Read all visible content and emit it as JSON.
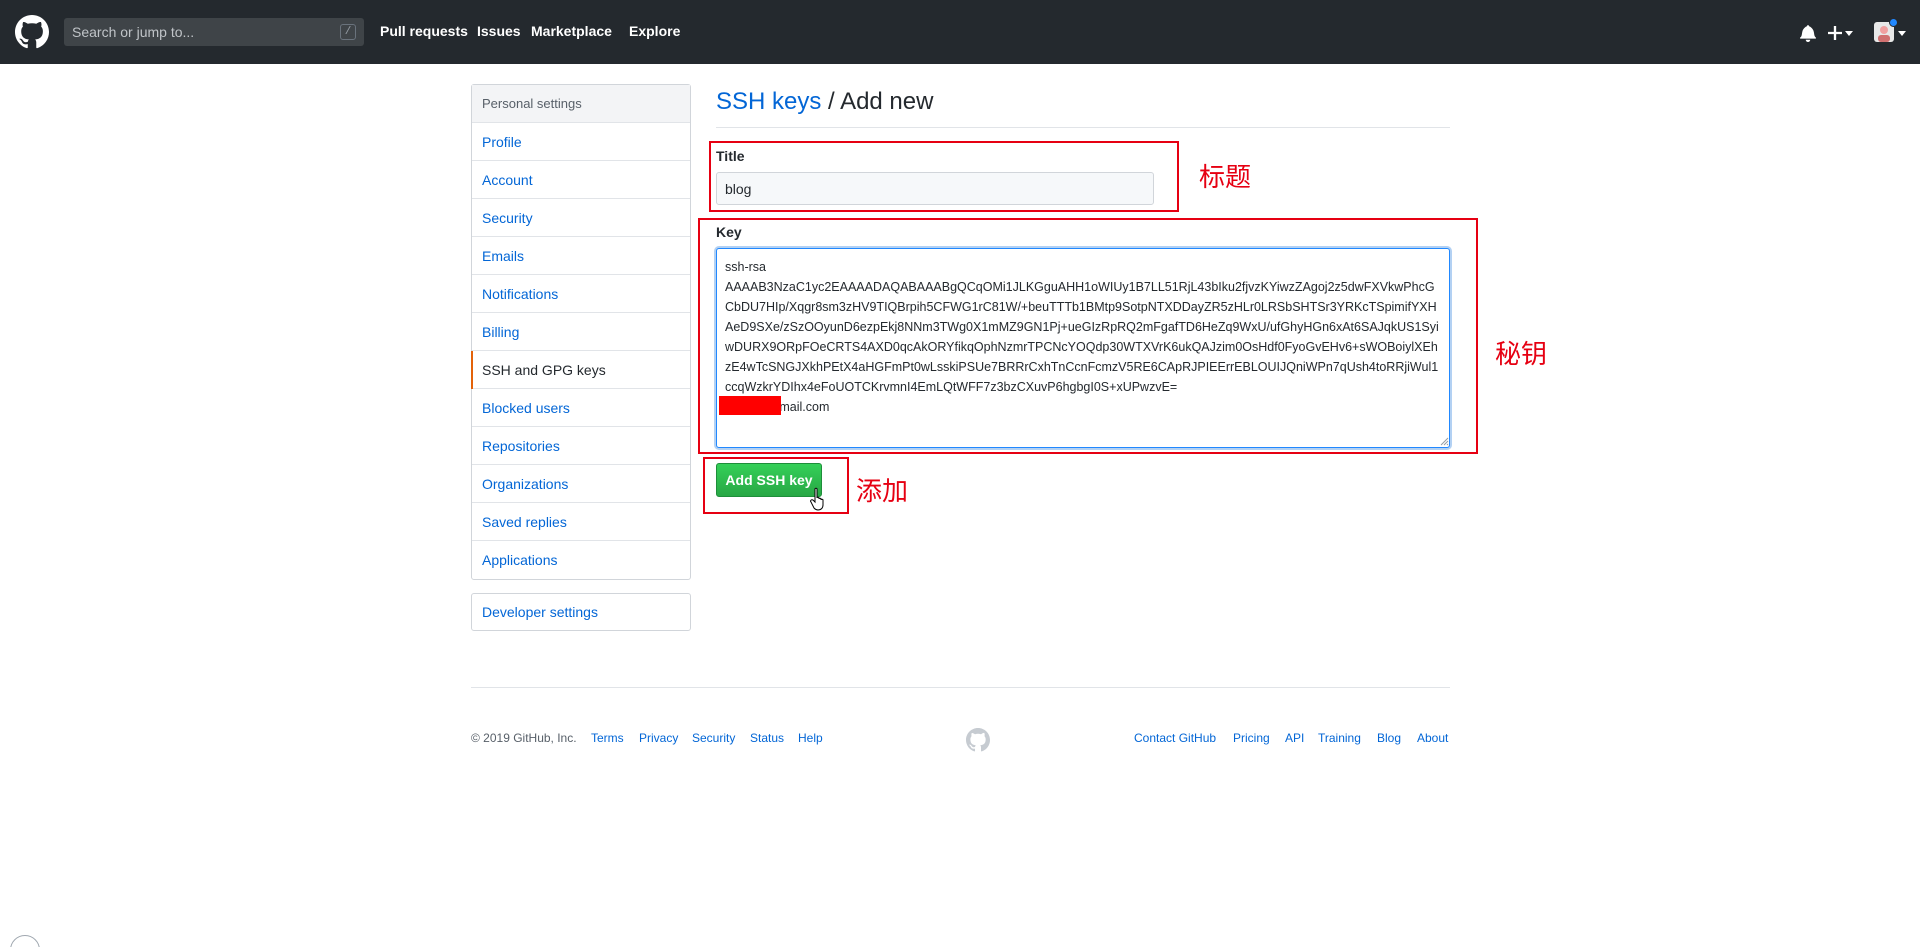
{
  "header": {
    "search_placeholder": "Search or jump to...",
    "slash_key": "/",
    "nav": [
      "Pull requests",
      "Issues",
      "Marketplace",
      "Explore"
    ]
  },
  "sidebar": {
    "heading": "Personal settings",
    "items": [
      "Profile",
      "Account",
      "Security",
      "Emails",
      "Notifications",
      "Billing",
      "SSH and GPG keys",
      "Blocked users",
      "Repositories",
      "Organizations",
      "Saved replies",
      "Applications"
    ],
    "active_index": 6,
    "developer_settings": "Developer settings"
  },
  "main": {
    "breadcrumb_link": "SSH keys",
    "breadcrumb_sep": " / ",
    "breadcrumb_current": "Add new",
    "title_label": "Title",
    "title_value": "blog",
    "key_label": "Key",
    "key_value": "ssh-rsa\nAAAAB3NzaC1yc2EAAAADAQABAAABgQCqOMi1JLKGguAHH1oWIUy1B7LL51RjL43bIku2fjvzKYiwzZAgoj2z5dwFXVkwPhcGCbDU7HIp/Xqgr8sm3zHV9TIQBrpih5CFWG1rC81W/+beuTTTb1BMtp9SotpNTXDDayZR5zHLr0LRSbSHTSr3YRKcTSpimifYXHAeD9SXe/zSzOOyunD6ezpEkj8NNm3TWg0X1mMZ9GN1Pj+ueGIzRpRQ2mFgafTD6HeZq9WxU/ufGhyHGn6xAt6SAJqkUS1SyiwDURX9ORpFOeCRTS4AXD0qcAkORYfikqOphNzmrTPCNcYOQdp30WTXVrK6ukQAJzim0OsHdf0FyoGvEHv6+sWOBoiylXEhzE4wTcSNGJXkhPEtX4aHGFmPt0wLsskiPSUe7BRRrCxhTnCcnFcmzV5RE6CApRJPIEErrEBLOUIJQniWPn7qUsh4toRRjiWul1ccqWzkrYDIhx4eFoUOTCKrvmnI4EmLQtWFF7z3bzCXuvP6hgbgI0S+xUPwzvE=\n          @gmail.com",
    "add_button": "Add SSH key"
  },
  "annotations": {
    "title": "标题",
    "key": "秘钥",
    "add": "添加",
    "color": "#e60012"
  },
  "footer": {
    "copyright": "© 2019 GitHub, Inc.",
    "left_links": [
      "Terms",
      "Privacy",
      "Security",
      "Status",
      "Help"
    ],
    "right_links": [
      "Contact GitHub",
      "Pricing",
      "API",
      "Training",
      "Blog",
      "About"
    ]
  },
  "colors": {
    "header_bg": "#24292e",
    "link": "#0366d6",
    "active_accent": "#e36209",
    "primary_button": "#28a745"
  }
}
